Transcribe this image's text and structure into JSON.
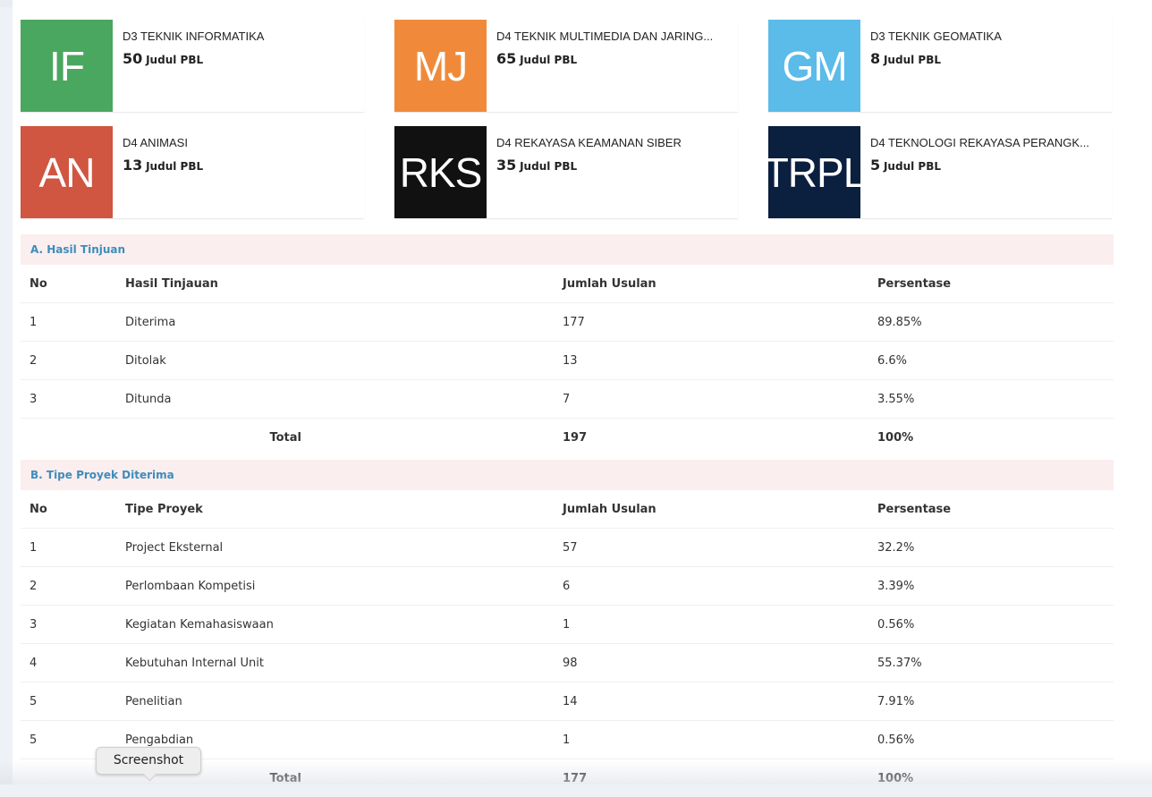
{
  "cards": [
    {
      "abbr": "IF",
      "title": "D3 TEKNIK INFORMATIKA",
      "count": "50",
      "unit": "Judul PBL",
      "color": "#4aa75f"
    },
    {
      "abbr": "MJ",
      "title": "D4 TEKNIK MULTIMEDIA DAN JARING...",
      "count": "65",
      "unit": "Judul PBL",
      "color": "#f08a3a"
    },
    {
      "abbr": "GM",
      "title": "D3 TEKNIK GEOMATIKA",
      "count": "8",
      "unit": "Judul PBL",
      "color": "#5bbbe9"
    },
    {
      "abbr": "AN",
      "title": "D4 ANIMASI",
      "count": "13",
      "unit": "Judul PBL",
      "color": "#d05641"
    },
    {
      "abbr": "RKS",
      "title": "D4 REKAYASA KEAMANAN SIBER",
      "count": "35",
      "unit": "Judul PBL",
      "color": "#111111"
    },
    {
      "abbr": "TRPL",
      "title": "D4 TEKNOLOGI REKAYASA PERANGK...",
      "count": "5",
      "unit": "Judul PBL",
      "color": "#0b1f3f"
    }
  ],
  "section_a": {
    "heading": "A. Hasil Tinjuan",
    "columns": [
      "No",
      "Hasil Tinjauan",
      "Jumlah Usulan",
      "Persentase"
    ],
    "rows": [
      [
        "1",
        "Diterima",
        "177",
        "89.85%"
      ],
      [
        "2",
        "Ditolak",
        "13",
        "6.6%"
      ],
      [
        "3",
        "Ditunda",
        "7",
        "3.55%"
      ]
    ],
    "total": {
      "label": "Total",
      "count": "197",
      "percent": "100%"
    }
  },
  "section_b": {
    "heading": "B. Tipe Proyek Diterima",
    "columns": [
      "No",
      "Tipe Proyek",
      "Jumlah Usulan",
      "Persentase"
    ],
    "rows": [
      [
        "1",
        "Project Eksternal",
        "57",
        "32.2%"
      ],
      [
        "2",
        "Perlombaan Kompetisi",
        "6",
        "3.39%"
      ],
      [
        "3",
        "Kegiatan Kemahasiswaan",
        "1",
        "0.56%"
      ],
      [
        "4",
        "Kebutuhan Internal Unit",
        "98",
        "55.37%"
      ],
      [
        "5",
        "Penelitian",
        "14",
        "7.91%"
      ],
      [
        "5",
        "Pengabdian",
        "1",
        "0.56%"
      ]
    ],
    "total": {
      "label": "Total",
      "count": "177",
      "percent": "100%"
    }
  },
  "tooltip": {
    "text": "Screenshot"
  }
}
